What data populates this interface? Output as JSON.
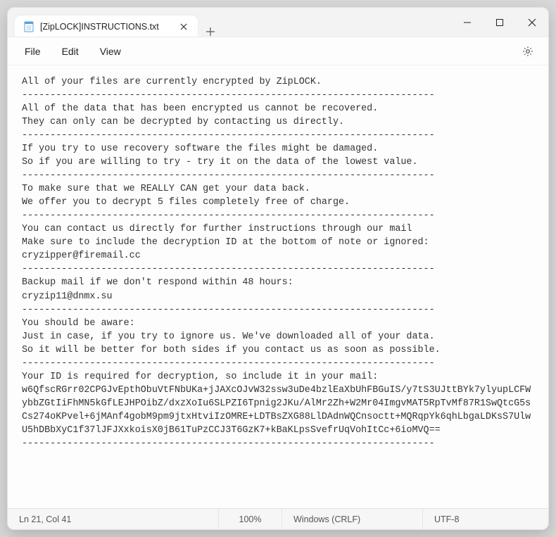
{
  "titlebar": {
    "tab_title": "[ZipLOCK]INSTRUCTIONS.txt"
  },
  "menubar": {
    "file": "File",
    "edit": "Edit",
    "view": "View"
  },
  "content": {
    "text": "All of your files are currently encrypted by ZipLOCK.\n-------------------------------------------------------------------------\nAll of the data that has been encrypted us cannot be recovered.\nThey can only can be decrypted by contacting us directly.\n-------------------------------------------------------------------------\nIf you try to use recovery software the files might be damaged.\nSo if you are willing to try - try it on the data of the lowest value.\n-------------------------------------------------------------------------\nTo make sure that we REALLY CAN get your data back.\nWe offer you to decrypt 5 files completely free of charge.\n-------------------------------------------------------------------------\nYou can contact us directly for further instructions through our mail\nMake sure to include the decryption ID at the bottom of note or ignored:\ncryzipper@firemail.cc\n-------------------------------------------------------------------------\nBackup mail if we don't respond within 48 hours:\ncryzip11@dnmx.su\n-------------------------------------------------------------------------\nYou should be aware:\nJust in case, if you try to ignore us. We've downloaded all of your data.\nSo it will be better for both sides if you contact us as soon as possible.\n-------------------------------------------------------------------------\nYour ID is required for decryption, so include it in your mail:\nw6QfscRGrr02CPGJvEpthObuVtFNbUKa+jJAXcOJvW32ssw3uDe4bzlEaXbUhFBGuIS/y7tS3UJttBYk7ylyupLCFWybbZGtIiFhMN5kGfLEJHPOibZ/dxzXoIu6SLPZI6Tpnig2JKu/AlMr2Zh+W2Mr04ImgvMAT5RpTvMf87R1SwQtcG5sCs274oKPvel+6jMAnf4gobM9pm9jtxHtviIzOMRE+LDTBsZXG88LlDAdnWQCnsoctt+MQRqpYk6qhLbgaLDKsS7UlwU5hDBbXyC1f37lJFJXxkoisX0jB61TuPzCCJ3T6GzK7+kBaKLpsSvefrUqVohItCc+6ioMVQ==\n-------------------------------------------------------------------------"
  },
  "statusbar": {
    "position": "Ln 21, Col 41",
    "zoom": "100%",
    "line_ending": "Windows (CRLF)",
    "encoding": "UTF-8"
  }
}
